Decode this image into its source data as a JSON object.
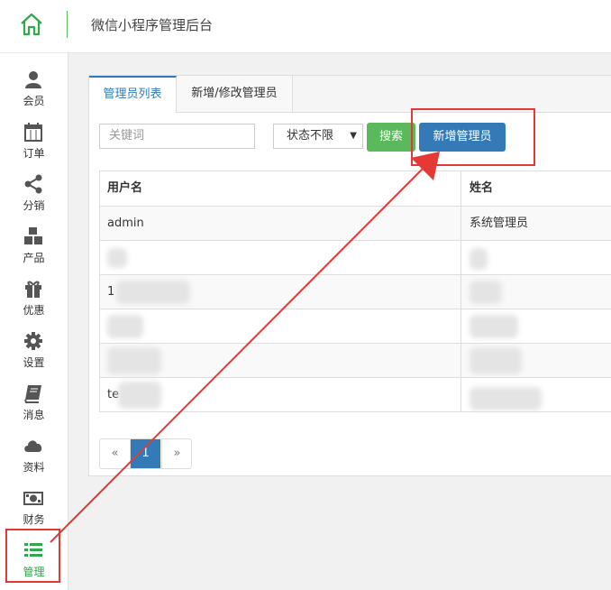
{
  "header": {
    "title": "微信小程序管理后台",
    "home_icon": "home-icon"
  },
  "sidebar": {
    "items": [
      {
        "label": "会员",
        "icon": "user-icon"
      },
      {
        "label": "订单",
        "icon": "calendar-icon"
      },
      {
        "label": "分销",
        "icon": "share-icon"
      },
      {
        "label": "产品",
        "icon": "cubes-icon"
      },
      {
        "label": "优惠",
        "icon": "gift-icon"
      },
      {
        "label": "设置",
        "icon": "gear-icon"
      },
      {
        "label": "消息",
        "icon": "book-icon"
      },
      {
        "label": "资料",
        "icon": "cloud-icon"
      },
      {
        "label": "财务",
        "icon": "money-icon"
      },
      {
        "label": "管理",
        "icon": "list-icon",
        "active": true
      }
    ]
  },
  "tabs": [
    {
      "label": "管理员列表",
      "active": true
    },
    {
      "label": "新增/修改管理员",
      "active": false
    }
  ],
  "filters": {
    "keyword_placeholder": "关键词",
    "status_value": "状态不限",
    "search_label": "搜索",
    "add_label": "新增管理员"
  },
  "table": {
    "headers": [
      "用户名",
      "姓名"
    ],
    "rows": [
      {
        "username": "admin",
        "name": "系统管理员"
      },
      {
        "username": "",
        "name": ""
      },
      {
        "username": "1",
        "name": ""
      },
      {
        "username": "",
        "name": ""
      },
      {
        "username": "",
        "name": ""
      },
      {
        "username": "te",
        "name": ""
      }
    ]
  },
  "pagination": {
    "prev": "«",
    "current": "1",
    "next": "»"
  },
  "colors": {
    "accent_green": "#5cb85c",
    "primary_blue": "#337ab7",
    "annotation_red": "#e53935"
  }
}
